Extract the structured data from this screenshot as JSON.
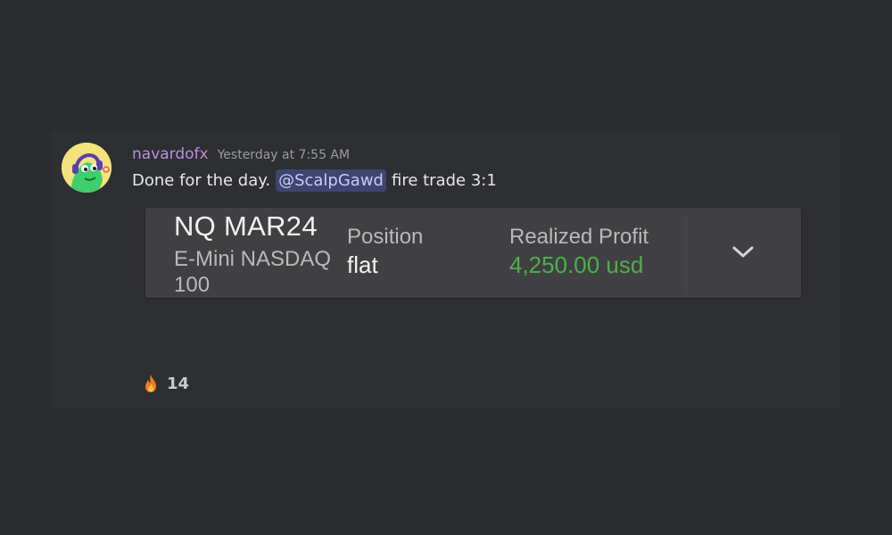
{
  "message": {
    "author": "navardofx",
    "timestamp": "Yesterday at 7:55 AM",
    "text_before": "Done for the day.",
    "mention": "@ScalpGawd",
    "text_after": "fire trade 3:1"
  },
  "trade_card": {
    "symbol": "NQ MAR24",
    "description": "E-Mini NASDAQ 100",
    "position_label": "Position",
    "position_value": "flat",
    "profit_label": "Realized Profit",
    "profit_value": "4,250.00 usd",
    "expand_icon": "chevron-down-icon"
  },
  "reaction": {
    "emoji_icon": "fire-icon",
    "count": "14"
  },
  "colors": {
    "background": "#2b2c30",
    "username": "#b88de0",
    "mention_bg": "#3e4572",
    "profit": "#4bb04b",
    "card_bg": "#404042"
  }
}
